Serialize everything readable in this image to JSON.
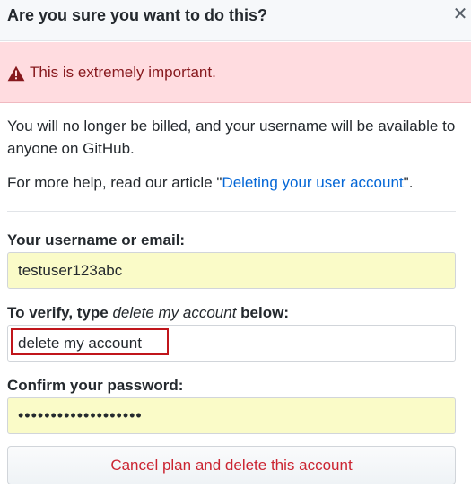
{
  "dialog": {
    "title": "Are you sure you want to do this?",
    "close_glyph": "✕"
  },
  "flash": {
    "icon": "alert-triangle-icon",
    "text": "This is extremely important."
  },
  "body": {
    "warning_text": "You will no longer be billed, and your username will be available to anyone on GitHub.",
    "help_prefix": "For more help, read our article \"",
    "help_link": "Deleting your user account",
    "help_suffix": "\"."
  },
  "form": {
    "username_label": "Your username or email:",
    "username_value": "testuser123abc",
    "verify_label_prefix": "To verify, type ",
    "verify_phrase": "delete my account",
    "verify_label_suffix": " below:",
    "verify_value": "delete my account",
    "password_label": "Confirm your password:",
    "password_value": "•••••••••••••••••••",
    "submit_label": "Cancel plan and delete this account"
  },
  "colors": {
    "flash_bg": "#ffdce0",
    "flash_text": "#86181d",
    "autofill_bg": "#fafbc8",
    "danger": "#cb2431",
    "link": "#0366d6",
    "highlight": "#c0151b"
  }
}
